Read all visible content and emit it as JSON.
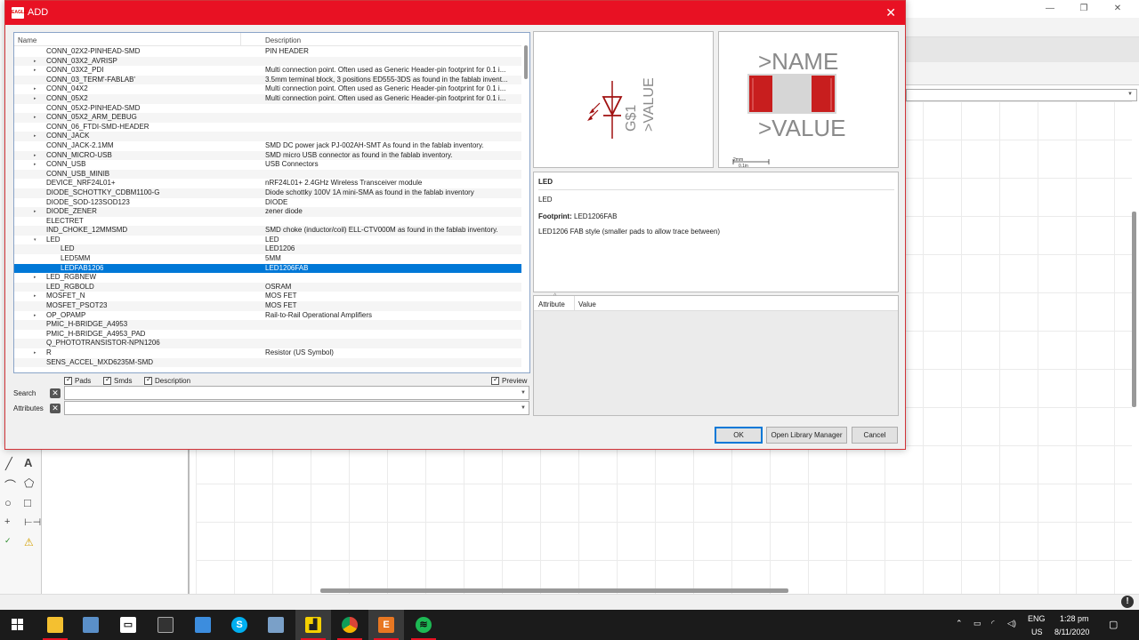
{
  "dialog": {
    "title": "ADD",
    "app_icon_text": "EAGLE",
    "close_glyph": "✕",
    "columns": {
      "name": "Name",
      "description": "Description"
    },
    "rows": [
      {
        "name": "CONN_02X2-PINHEAD-SMD",
        "desc": "PIN HEADER",
        "exp": ""
      },
      {
        "name": "CONN_03X2_AVRISP",
        "desc": "",
        "exp": "▸"
      },
      {
        "name": "CONN_03X2_PDI",
        "desc": "Multi connection point. Often used as Generic Header-pin footprint for 0.1 i...",
        "exp": "▸"
      },
      {
        "name": "CONN_03_TERM'-FABLAB'",
        "desc": "3.5mm terminal block, 3 positions ED555-3DS as found in the fablab invent...",
        "exp": ""
      },
      {
        "name": "CONN_04X2",
        "desc": "Multi connection point. Often used as Generic Header-pin footprint for 0.1 i...",
        "exp": "▸"
      },
      {
        "name": "CONN_05X2",
        "desc": "Multi connection point. Often used as Generic Header-pin footprint for 0.1 i...",
        "exp": "▸"
      },
      {
        "name": "CONN_05X2-PINHEAD-SMD",
        "desc": "",
        "exp": ""
      },
      {
        "name": "CONN_05X2_ARM_DEBUG",
        "desc": "",
        "exp": "▸"
      },
      {
        "name": "CONN_06_FTDI-SMD-HEADER",
        "desc": "",
        "exp": ""
      },
      {
        "name": "CONN_JACK",
        "desc": "",
        "exp": "▸"
      },
      {
        "name": "CONN_JACK-2.1MM",
        "desc": "SMD DC power jack PJ-002AH-SMT As found in the fablab inventory.",
        "exp": ""
      },
      {
        "name": "CONN_MICRO-USB",
        "desc": "SMD micro USB connector as found in the fablab inventory.",
        "exp": "▸"
      },
      {
        "name": "CONN_USB",
        "desc": "USB Connectors",
        "exp": "▸"
      },
      {
        "name": "CONN_USB_MINIB",
        "desc": "",
        "exp": ""
      },
      {
        "name": "DEVICE_NRF24L01+",
        "desc": "nRF24L01+ 2.4GHz Wireless Transceiver module",
        "exp": ""
      },
      {
        "name": "DIODE_SCHOTTKY_CDBM1100-G",
        "desc": "Diode schottky 100V 1A mini-SMA as found in the fablab inventory",
        "exp": ""
      },
      {
        "name": "DIODE_SOD-123SOD123",
        "desc": "DIODE",
        "exp": ""
      },
      {
        "name": "DIODE_ZENER",
        "desc": "zener diode",
        "exp": "▸"
      },
      {
        "name": "ELECTRET",
        "desc": "",
        "exp": ""
      },
      {
        "name": "IND_CHOKE_12MMSMD",
        "desc": "SMD choke (inductor/coil) ELL-CTV000M as found in the fablab inventory.",
        "exp": ""
      },
      {
        "name": "LED",
        "desc": "LED",
        "exp": "▾"
      },
      {
        "name": "LED",
        "desc": "LED1206",
        "exp": "",
        "child": true
      },
      {
        "name": "LED5MM",
        "desc": "5MM",
        "exp": "",
        "child": true
      },
      {
        "name": "LEDFAB1206",
        "desc": "LED1206FAB",
        "exp": "",
        "child": true,
        "selected": true
      },
      {
        "name": "LED_RGBNEW",
        "desc": "",
        "exp": "▸"
      },
      {
        "name": "LED_RGBOLD",
        "desc": "OSRAM",
        "exp": ""
      },
      {
        "name": "MOSFET_N",
        "desc": "MOS FET",
        "exp": "▸"
      },
      {
        "name": "MOSFET_PSOT23",
        "desc": "MOS FET",
        "exp": ""
      },
      {
        "name": "OP_OPAMP",
        "desc": "Rail-to-Rail Operational Amplifiers",
        "exp": "▸"
      },
      {
        "name": "PMIC_H-BRIDGE_A4953",
        "desc": "",
        "exp": ""
      },
      {
        "name": "PMIC_H-BRIDGE_A4953_PAD",
        "desc": "",
        "exp": ""
      },
      {
        "name": "Q_PHOTOTRANSISTOR-NPN1206",
        "desc": "",
        "exp": ""
      },
      {
        "name": "R",
        "desc": "Resistor (US Symbol)",
        "exp": "▸"
      },
      {
        "name": "SENS_ACCEL_MXD6235M-SMD",
        "desc": "",
        "exp": ""
      }
    ],
    "checks": {
      "pads": "Pads",
      "smds": "Smds",
      "description": "Description",
      "preview": "Preview"
    },
    "search_label": "Search",
    "attributes_label": "Attributes",
    "symbol": {
      "name": "G$1",
      "value": ">VALUE"
    },
    "package": {
      "name": ">NAME",
      "value": ">VALUE",
      "scale_mm": "2mm",
      "scale_in": "0.1in"
    },
    "info": {
      "title": "LED",
      "subtitle": "LED",
      "footprint_label": "Footprint:",
      "footprint_value": "LED1206FAB",
      "description": "LED1206 FAB style (smaller pads to allow trace between)"
    },
    "attr_columns": {
      "attribute": "Attribute",
      "value": "Value"
    },
    "buttons": {
      "ok": "OK",
      "library_manager": "Open Library Manager",
      "cancel": "Cancel"
    }
  },
  "taskbar": {
    "language": "ENG",
    "region": "US",
    "time": "1:28 pm",
    "date": "8/11/2020"
  },
  "colors": {
    "title_bar": "#e81123",
    "selection": "#0078d7",
    "pad": "#c81e1e"
  }
}
